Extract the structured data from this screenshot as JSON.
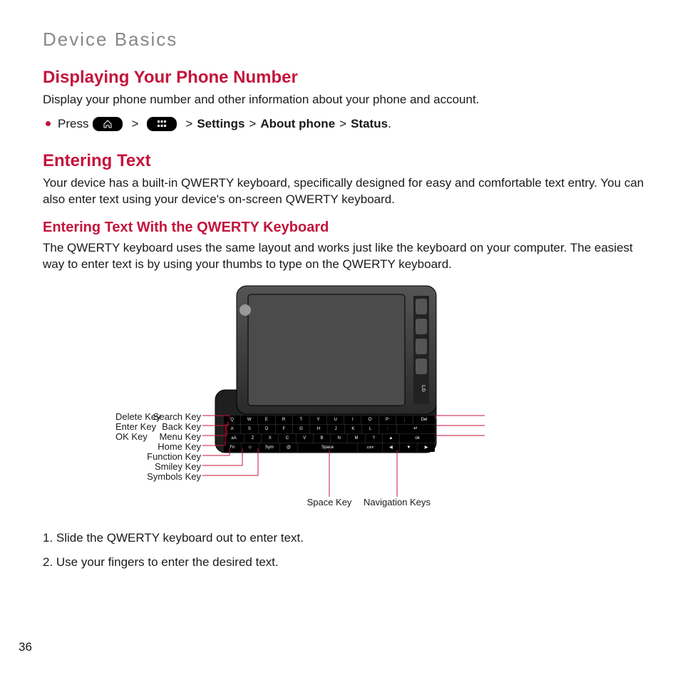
{
  "header": "Device Basics",
  "section1": {
    "title": "Displaying Your Phone Number",
    "intro": "Display your phone number and other information about your phone and account.",
    "bullet": {
      "press": "Press",
      "gt": ">",
      "path_settings": "Settings",
      "path_about": "About phone",
      "path_status": "Status",
      "period": "."
    }
  },
  "section2": {
    "title": "Entering Text",
    "intro": "Your device has a built-in QWERTY keyboard, specifically designed for easy and comfortable text entry. You can also enter text using your device's on-screen QWERTY keyboard.",
    "sub_title": "Entering Text With the QWERTY Keyboard",
    "sub_intro": "The QWERTY keyboard uses the same layout and works just like the keyboard on your computer. The easiest way to enter text is by using your thumbs to type on the QWERTY keyboard."
  },
  "labels": {
    "left": [
      "Search Key",
      "Back Key",
      "Menu Key",
      "Home Key",
      "Function Key",
      "Smiley Key",
      "Symbols Key"
    ],
    "right": [
      "Delete Key",
      "Enter Key",
      "OK Key"
    ],
    "bottom": [
      "Space Key",
      "Navigation Keys"
    ]
  },
  "steps": {
    "s1": "1. Slide the QWERTY keyboard out to enter text.",
    "s2": "2. Use your fingers to enter the desired text."
  },
  "page_number": "36",
  "brand": "LG",
  "key_rows": {
    "r1": [
      "Q",
      "W",
      "E",
      "R",
      "T",
      "Y",
      "U",
      "I",
      "O",
      "P",
      ";",
      "Del"
    ],
    "r2": [
      "A",
      "S",
      "D",
      "F",
      "G",
      "H",
      "J",
      "K",
      "L",
      ":",
      "↵"
    ],
    "r3": [
      "aA",
      "Z",
      "X",
      "C",
      "V",
      "B",
      "N",
      "M",
      "?",
      ".",
      "ok"
    ],
    "r4": [
      "Fn",
      "☺",
      "Sym",
      "@",
      "Space",
      ".com",
      "◀",
      "▼",
      "▶"
    ]
  }
}
